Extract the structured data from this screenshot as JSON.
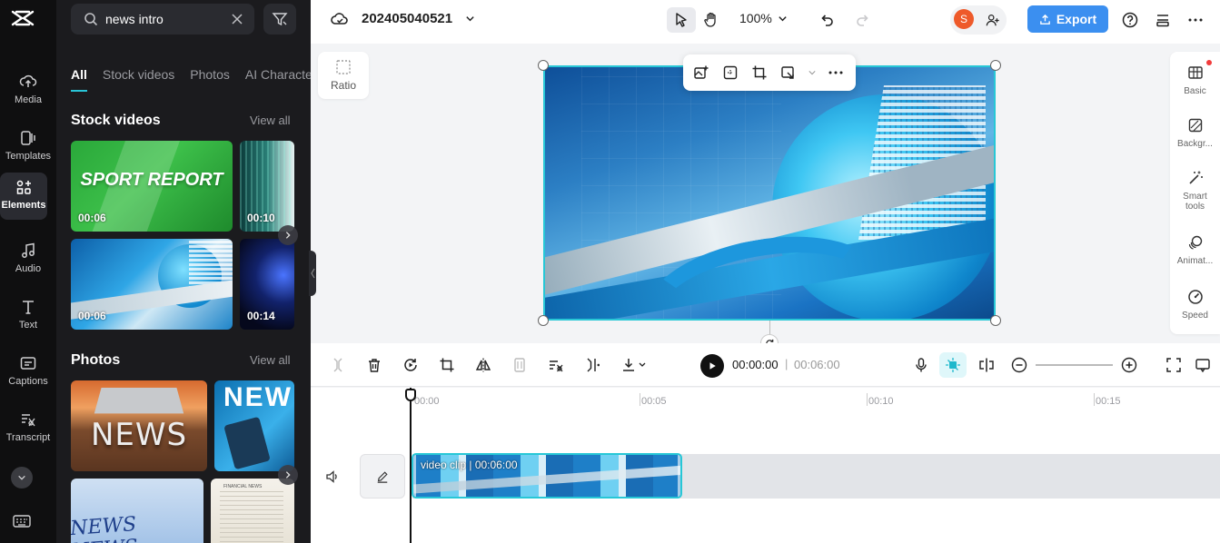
{
  "rail": {
    "items": [
      {
        "label": "Media",
        "icon": "cloud-upload-icon"
      },
      {
        "label": "Templates",
        "icon": "templates-icon"
      },
      {
        "label": "Elements",
        "icon": "elements-icon"
      },
      {
        "label": "Audio",
        "icon": "music-note-icon"
      },
      {
        "label": "Text",
        "icon": "text-icon"
      },
      {
        "label": "Captions",
        "icon": "captions-icon"
      },
      {
        "label": "Transcript",
        "icon": "transcript-icon"
      }
    ]
  },
  "panel": {
    "search": {
      "value": "news intro",
      "placeholder": "Search"
    },
    "tabs": [
      "All",
      "Stock videos",
      "Photos",
      "AI Characters"
    ],
    "stock_videos": {
      "title": "Stock videos",
      "view_all": "View all",
      "items": [
        {
          "duration": "00:06",
          "caption": "SPORT REPORT"
        },
        {
          "duration": "00:10"
        },
        {
          "duration": "00:06"
        },
        {
          "duration": "00:14"
        }
      ]
    },
    "photos": {
      "title": "Photos",
      "view_all": "View all",
      "items": [
        {
          "caption": "NEWS"
        },
        {
          "caption": "NEW"
        },
        {
          "caption": "NEWS NEWS"
        },
        {
          "caption": "FINANCIAL NEWS"
        }
      ]
    }
  },
  "topbar": {
    "project_name": "202405040521",
    "zoom": "100%",
    "avatar_initial": "S",
    "export_label": "Export"
  },
  "canvas": {
    "ratio_label": "Ratio"
  },
  "right_panel": {
    "items": [
      {
        "label": "Basic"
      },
      {
        "label": "Backgr..."
      },
      {
        "label": "Smart tools"
      },
      {
        "label": "Animat..."
      },
      {
        "label": "Speed"
      }
    ]
  },
  "timeline": {
    "current_time": "00:00:00",
    "separator": "|",
    "total_time": "00:06:00",
    "ruler": [
      "00:00",
      "00:05",
      "00:10",
      "00:15"
    ],
    "clip_label": "video clip",
    "clip_duration": "00:06:00"
  },
  "colors": {
    "accent": "#27c7d6",
    "export": "#3b8ff0",
    "avatar": "#ee5a2a",
    "sidebar_bg": "#0f0f10",
    "panel_bg": "#1b1b1e"
  }
}
